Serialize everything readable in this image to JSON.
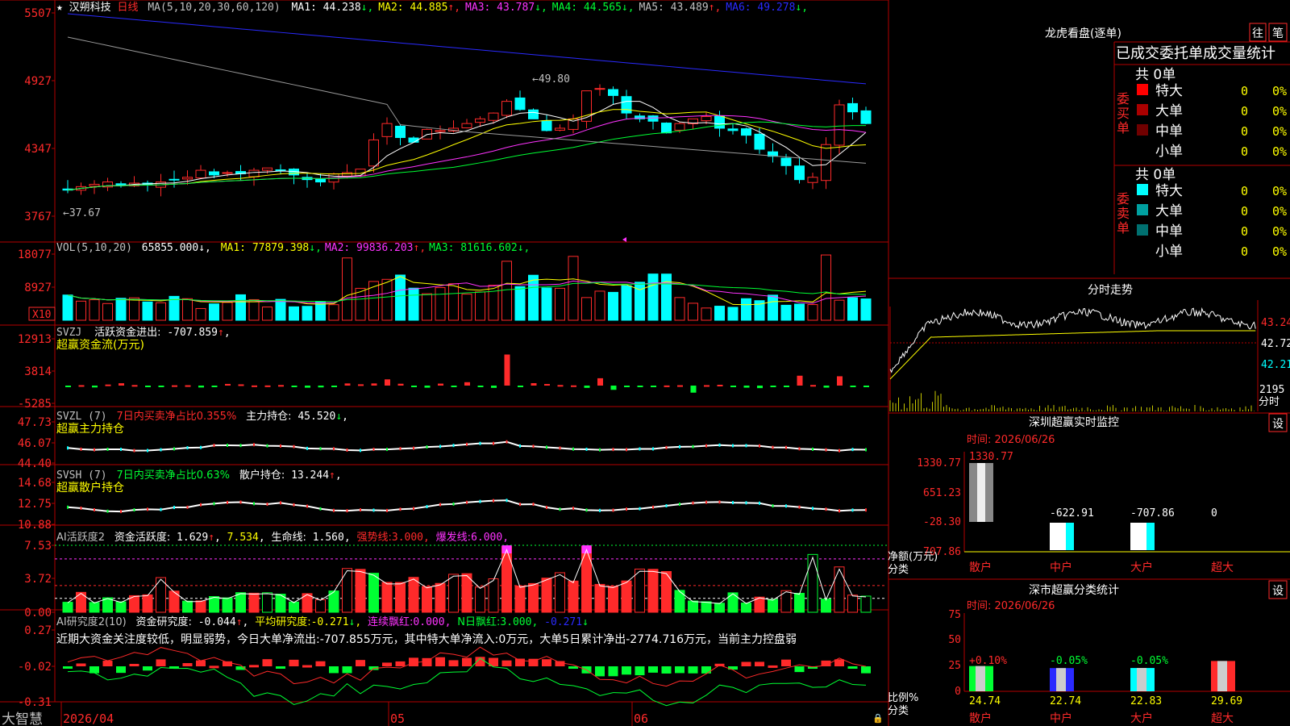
{
  "colors": {
    "up": "#ff2a2a",
    "down": "#00ffff",
    "grid": "#b40000",
    "text": "#c0c0c0",
    "yellow": "#ffff00",
    "white": "#ffffff",
    "magenta": "#ff33ff",
    "green": "#00ff33",
    "blue": "#2a2aff",
    "gray": "#9a9a9a",
    "olive": "#c8c800"
  },
  "stock": {
    "star": "★",
    "name": "汉朔科技",
    "period": "日线"
  },
  "price_panel": {
    "ma_header": "MA(5,10,20,30,60,120)",
    "ma": [
      {
        "label": "MA1:",
        "value": "44.238",
        "arrow": "↓",
        "color": "#ffffff"
      },
      {
        "label": "MA2:",
        "value": "44.885",
        "arrow": "↑",
        "color": "#ffff00"
      },
      {
        "label": "MA3:",
        "value": "43.787",
        "arrow": "↓",
        "color": "#ff33ff"
      },
      {
        "label": "MA4:",
        "value": "44.565",
        "arrow": "↓",
        "color": "#00ff33"
      },
      {
        "label": "MA5:",
        "value": "43.489",
        "arrow": "↑",
        "color": "#c0c0c0"
      },
      {
        "label": "MA6:",
        "value": "49.278",
        "arrow": "↓",
        "color": "#2a2aff"
      }
    ],
    "y_ticks": [
      "5507",
      "4927",
      "4347",
      "3767"
    ],
    "high_mark": "49.80",
    "low_mark": "37.67"
  },
  "vol_panel": {
    "title": "VOL(5,10,20)",
    "value": "65855.000",
    "ma": [
      {
        "label": "MA1:",
        "value": "77879.398",
        "arrow": "↓",
        "color": "#ffff00"
      },
      {
        "label": "MA2:",
        "value": "99836.203",
        "arrow": "↑",
        "color": "#ff33ff"
      },
      {
        "label": "MA3:",
        "value": "81616.602",
        "arrow": "↓",
        "color": "#00ff33"
      }
    ],
    "y_ticks": [
      "18077",
      "8927"
    ],
    "unit": "X10"
  },
  "svzj_panel": {
    "title": "SVZJ",
    "label": "活跃资金进出:",
    "value": "-707.859",
    "arrow": "↑",
    "subtitle": "超赢资金流(万元)",
    "y_ticks": [
      "12913",
      "3814",
      "-5285"
    ]
  },
  "svzl_panel": {
    "title": "SVZL (7)",
    "label": "7日内买卖净占比0.355%",
    "label2": "主力持仓:",
    "value": "45.520",
    "arrow": "↓",
    "subtitle": "超赢主力持仓",
    "y_ticks": [
      "47.73",
      "46.07",
      "44.40"
    ]
  },
  "svsh_panel": {
    "title": "SVSH (7)",
    "label": "7日内买卖净占比0.63%",
    "label2": "散户持仓:",
    "value": "13.244",
    "arrow": "↑",
    "subtitle": "超赢散户持仓",
    "y_ticks": [
      "14.68",
      "12.75",
      "10.88"
    ]
  },
  "ai_act_panel": {
    "title": "AI活跃度2",
    "label": "资金活跃度:",
    "value": "1.629",
    "arrow": "↑",
    "value2": "7.534",
    "label3": "生命线:",
    "value3": "1.560",
    "strong_label": "强势线:",
    "strong_value": "3.000",
    "burst_label": "爆发线:",
    "burst_value": "6.000",
    "y_ticks": [
      "7.53",
      "3.72",
      "0.00"
    ]
  },
  "ai_res_panel": {
    "title": "AI研究度2(10)",
    "label": "资金研究度:",
    "value": "-0.044",
    "arrow": "↑",
    "avg_label": "平均研究度:",
    "avg_value": "-0.271",
    "avg_arrow": "↓",
    "red_label": "连续飘红:",
    "red_value": "0.000",
    "n_label": "N日飘红:",
    "n_value": "3.000",
    "extra": "-0.271",
    "comment": "近期大资金关注度较低，明显弱势，今日大单净流出:-707.855万元，其中特大单净流入:0万元，大单5日累计净出-2774.716万元，当前主力控盘弱",
    "y_ticks": [
      "0.27",
      "-0.02",
      "-0.31"
    ]
  },
  "bottom_bar": {
    "brand": "大智慧",
    "dates": [
      "2026/04",
      "05",
      "06"
    ]
  },
  "right_panel": {
    "lhb_title": "龙虎看盘(逐单)",
    "tab1": "往",
    "tab2": "笔",
    "stat_title": "已成交委托单成交量统计",
    "buy_group": "委买单",
    "sell_group": "委卖单",
    "buy_total": "共 0单",
    "sell_total": "共 0单",
    "buy_rows": [
      {
        "label": "特大",
        "count": "0",
        "pct": "0%",
        "color": "#ff0000"
      },
      {
        "label": "大单",
        "count": "0",
        "pct": "0%",
        "color": "#aa0000"
      },
      {
        "label": "中单",
        "count": "0",
        "pct": "0%",
        "color": "#700000"
      },
      {
        "label": "小单",
        "count": "0",
        "pct": "0%",
        "color": ""
      }
    ],
    "sell_rows": [
      {
        "label": "特大",
        "count": "0",
        "pct": "0%",
        "color": "#00ffff"
      },
      {
        "label": "大单",
        "count": "0",
        "pct": "0%",
        "color": "#00a0a0"
      },
      {
        "label": "中单",
        "count": "0",
        "pct": "0%",
        "color": "#007070"
      },
      {
        "label": "小单",
        "count": "0",
        "pct": "0%",
        "color": ""
      }
    ],
    "intraday_title": "分时走势",
    "intraday_y": [
      "43.24",
      "42.72",
      "42.21"
    ],
    "intraday_vol": "2195",
    "intraday_vol_label": "分时",
    "monitor_title": "深圳超赢实时监控",
    "settings_label": "设",
    "monitor_time": "时间: 2026/06/26",
    "monitor_y": [
      "1330.77",
      "651.23",
      "-28.30",
      "-707.86"
    ],
    "monitor_axis": [
      "净额(万元)",
      "分类"
    ],
    "monitor_bars": [
      {
        "cat": "散户",
        "value": 1330.77,
        "label": "1330.77"
      },
      {
        "cat": "中户",
        "value": -622.91,
        "label": "-622.91"
      },
      {
        "cat": "大户",
        "value": -707.86,
        "label": "-707.86"
      },
      {
        "cat": "超大",
        "value": 0,
        "label": "0"
      }
    ],
    "class_title": "深市超赢分类统计",
    "class_time": "时间: 2026/06/26",
    "class_y": [
      "75",
      "50",
      "25",
      "0"
    ],
    "class_axis": [
      "比例%",
      "分类"
    ],
    "class_bars": [
      {
        "cat": "散户",
        "value": 24.74,
        "label": "24.74",
        "delta": "+0.10%"
      },
      {
        "cat": "中户",
        "value": 22.74,
        "label": "22.74",
        "delta": "-0.05%"
      },
      {
        "cat": "大户",
        "value": 22.83,
        "label": "22.83",
        "delta": "-0.05%"
      },
      {
        "cat": "超大",
        "value": 29.69,
        "label": "29.69",
        "delta": ""
      }
    ]
  }
}
